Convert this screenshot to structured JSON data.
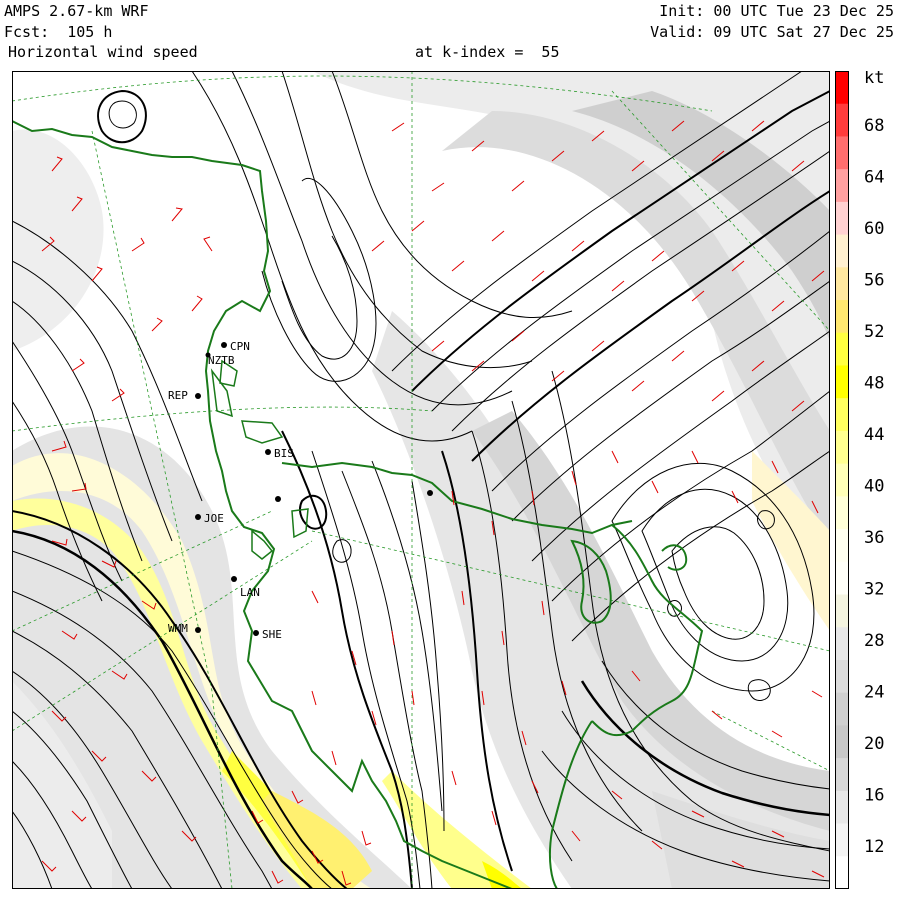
{
  "header": {
    "model": "AMPS 2.67-km WRF",
    "forecast": "Fcst:  105 h",
    "field": "Horizontal wind speed",
    "level": "at k-index =  55",
    "init": "Init: 00 UTC Tue 23 Dec 25",
    "valid": "Valid: 09 UTC Sat 27 Dec 25"
  },
  "colorbar": {
    "unit": "kt",
    "labels": [
      "68",
      "64",
      "60",
      "56",
      "52",
      "48",
      "44",
      "40",
      "36",
      "32",
      "28",
      "24",
      "20",
      "16",
      "12"
    ],
    "colors": [
      "#ff0000",
      "#ff3c3c",
      "#ff6e6e",
      "#ffa0a0",
      "#ffd2d2",
      "#fff0d0",
      "#ffe8a0",
      "#ffe870",
      "#ffff40",
      "#ffff00",
      "#ffff60",
      "#ffff90",
      "#ffffb8",
      "#ffffd8",
      "#fffff0",
      "#fffff8",
      "#f4f4e0",
      "#e8e8e8",
      "#dcdcdc",
      "#d0d0d0",
      "#c8c8c8",
      "#d8d8d8",
      "#e8e8e8",
      "#f4f4f4",
      "#ffffff"
    ]
  },
  "stations": [
    {
      "id": "CPN"
    },
    {
      "id": "NZTB"
    },
    {
      "id": "REP"
    },
    {
      "id": "BIS"
    },
    {
      "id": "JOE"
    },
    {
      "id": "LAN"
    },
    {
      "id": "WMM"
    },
    {
      "id": "SHE"
    }
  ]
}
